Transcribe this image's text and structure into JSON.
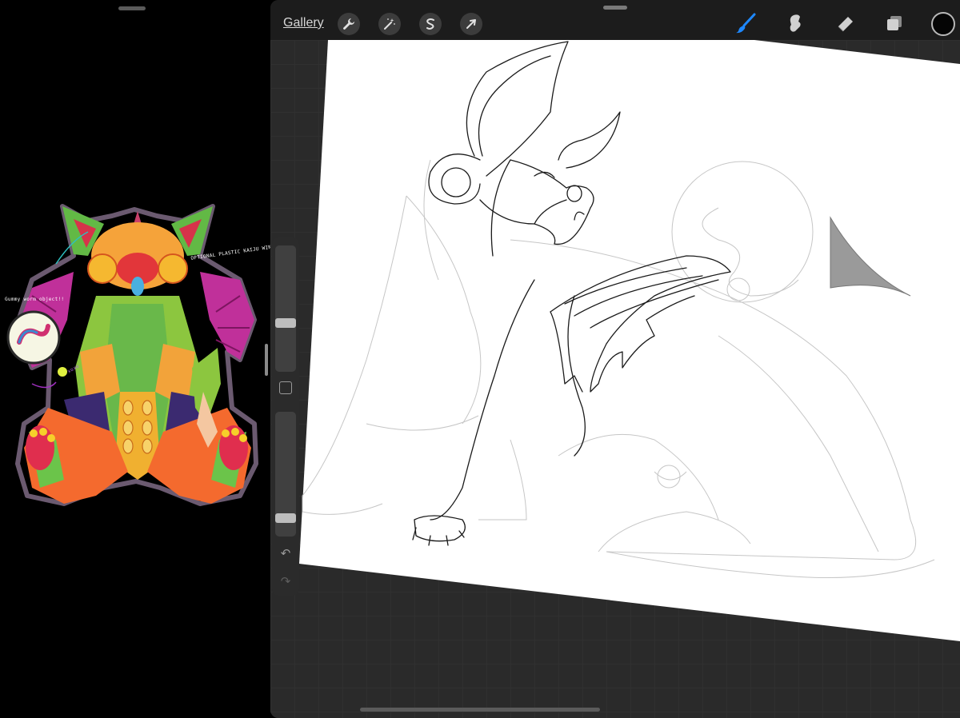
{
  "reference_pane": {
    "note_top": "OPTIONAL PLASTIC KAIJU WINGS!",
    "note_left": "Gummy worm object!!",
    "note_small": "xoxo"
  },
  "toolbar": {
    "gallery_label": "Gallery",
    "left_tools": [
      "wrench-icon",
      "magic-wand-icon",
      "selection-s-icon",
      "transform-arrow-icon"
    ],
    "right_tools": [
      "brush-icon",
      "smudge-icon",
      "eraser-icon",
      "layers-icon"
    ],
    "active_tool": "brush",
    "accent_color": "#1e88ff",
    "current_color": "#050505"
  },
  "sidebar": {
    "brush_size_level": 0.38,
    "opacity_level": 0.12
  },
  "canvas": {
    "background": "#ffffff"
  }
}
